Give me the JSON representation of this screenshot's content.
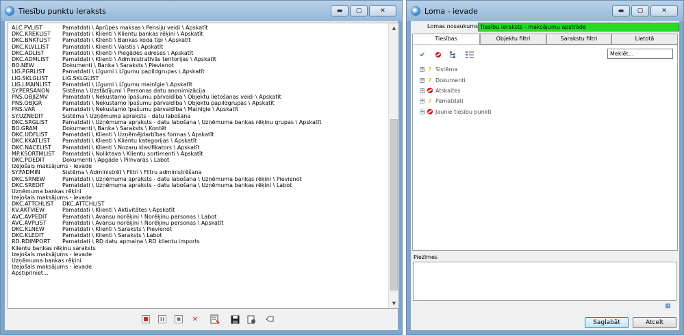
{
  "left_window": {
    "title": "Tiesību punktu ieraksts",
    "controls": {
      "minimize": "▬",
      "maximize": "▢",
      "close": "✕"
    },
    "log": [
      {
        "code": "ALC.PVLIST",
        "path": "Pamatdati \\ Aprūpes maksas \\ Pensiju veidi \\ Apskatīt"
      },
      {
        "code": "DKC.KREKLIST",
        "path": "Pamatdati \\ Klienti \\ Klientu bankas rēķini \\ Apskatīt"
      },
      {
        "code": "DKC.BNKTLIST",
        "path": "Pamatdati \\ Klienti \\ Bankas koda tipi \\ Apskatīt"
      },
      {
        "code": "DKC.KLVLLIST",
        "path": "Pamatdati \\ Klienti \\ Valstis \\ Apskatīt"
      },
      {
        "code": "DKC.ADLIST",
        "path": "Pamatdati \\ Klienti \\ Piegādes adreses \\ Apskatīt"
      },
      {
        "code": "DKC.ADMLIST",
        "path": "Pamatdati \\ Klienti \\ Administratīvās teritorijas \\ Apskatīt"
      },
      {
        "code": "BO.NEW",
        "path": "Dokumenti \\ Banka \\ Saraksts \\ Pievienot"
      },
      {
        "code": "LIG.PGRLIST",
        "path": "Pamatdati \\ Līgumi \\ Līgumu papildgrupas \\ Apskatīt"
      },
      {
        "code": "LIG.SKLGLIST",
        "path": "LIG.SKLGLIST"
      },
      {
        "code": "LIG.LMAINLIST",
        "path": "Pamatdati \\ Līgumi \\ Līgumu mainīgie \\ Apskatīt"
      },
      {
        "code": "SY.PERSANON",
        "path": "Sistēma \\ Uzstādījumi \\ Personas datu anonimizācija"
      },
      {
        "code": "PNS.OBJIZMV",
        "path": "Pamatdati \\ Nekustamo īpašumu pārvaldība \\ Objektu lietošanas veidi \\ Apskatīt"
      },
      {
        "code": "PNS.OBJGR",
        "path": "Pamatdati \\ Nekustamo īpašumu pārvaldība \\ Objektu papildgrupas \\ Apskatīt"
      },
      {
        "code": "PNS.VAR",
        "path": "Pamatdati \\ Nekustamo īpašumu pārvaldība \\ Mainīgie \\ Apskatīt"
      },
      {
        "code": "SY.UZNEDIT",
        "path": "Sistēma \\ Uzņēmuma apraksts - datu labošana"
      },
      {
        "code": "DKC.SRGLIST",
        "path": "Pamatdati \\ Uzņēmuma apraksts - datu labošana \\ Uzņēmuma bankas rēķinu grupas \\ Apskatīt"
      },
      {
        "code": "BO.GRAM",
        "path": "Dokumenti \\ Banka \\ Saraksts \\ Kontēt"
      },
      {
        "code": "DKC.UDFLIST",
        "path": "Pamatdati \\ Klienti \\ Uzņēmējdarbības formas \\ Apskatīt"
      },
      {
        "code": "DKC.KKATLIST",
        "path": "Pamatdati \\ Klienti \\ Klientu kategorijas \\ Apskatīt"
      },
      {
        "code": "DKC.NACELIST",
        "path": "Pamatdati \\ Klienti \\ Nozaru klasifikators \\ Apskatīt"
      },
      {
        "code": "MP.KSORTMLIST",
        "path": "Pamatdati \\ Noliktava \\ Klientu sortimenti \\ Apskatīt"
      },
      {
        "code": "DKC.PDEDIT",
        "path": "Dokumenti \\ Apgāde \\ Pilnvaras \\ Labot"
      },
      {
        "code": "",
        "path": "Izejošais maksājums - ievade"
      },
      {
        "code": "SY.FADMIN",
        "path": "Sistēma \\ Administrēt \\ Filtri \\ Filtru administrēšana"
      },
      {
        "code": "DKC.SRNEW",
        "path": "Pamatdati \\ Uzņēmuma apraksts - datu labošana \\ Uzņēmuma bankas rēķini \\ Pievienot"
      },
      {
        "code": "DKC.SREDIT",
        "path": "Pamatdati \\ Uzņēmuma apraksts - datu labošana \\ Uzņēmuma bankas rēķini \\ Labot"
      },
      {
        "code": "",
        "path": "Uzņēmuma bankas rēķini"
      },
      {
        "code": "",
        "path": "Izejošais maksājums - ievade"
      },
      {
        "code": "DKC.ATTCHLIST",
        "path": "DKC.ATTCHLIST"
      },
      {
        "code": "KV.AKTVIEW",
        "path": "Pamatdati \\ Klienti \\ Aktivitātes \\ Apskatīt"
      },
      {
        "code": "AVC.AVPEDIT",
        "path": "Pamatdati \\ Avansu norēķini \\ Norēķinu personas \\ Labot"
      },
      {
        "code": "AVC.AVPLIST",
        "path": "Pamatdati \\ Avansu norēķini \\ Norēķinu personas \\ Apskatīt"
      },
      {
        "code": "DKC.KLNEW",
        "path": "Pamatdati \\ Klienti \\ Saraksts \\ Pievienot"
      },
      {
        "code": "DKC.KLEDIT",
        "path": "Pamatdati \\ Klienti \\ Saraksts \\ Labot"
      },
      {
        "code": "RD.RDIMPORT",
        "path": "Pamatdati \\ RD datu apmaiņa \\ RD klientu imports"
      },
      {
        "code": "",
        "path": "Klientu bankas rēķinu saraksts"
      },
      {
        "code": "",
        "path": "Izejošais maksājums - ievade"
      },
      {
        "code": "",
        "path": "Uzņēmuma bankas rēķini"
      },
      {
        "code": "",
        "path": "Izejošais maksājums - ievade"
      },
      {
        "code": "",
        "path": "Apstipriniet..."
      }
    ]
  },
  "right_window": {
    "title": "Loma - ievade",
    "controls": {
      "minimize": "▬",
      "maximize": "▢",
      "close": "✕"
    },
    "role_name_label": "Lomas nosaukums:",
    "role_name_value": "Tiesību ieraksts - maksājumu apstrāde",
    "tabs": [
      "Tiesības",
      "Objektu filtri",
      "Sarakstu filtri",
      "Lietotā"
    ],
    "search_placeholder": "Meklēt...",
    "tree": [
      {
        "label": "Sistēma",
        "status": "q"
      },
      {
        "label": "Dokumenti",
        "status": "q"
      },
      {
        "label": "Atskaites",
        "status": "no"
      },
      {
        "label": "Pamatdati",
        "status": "q"
      },
      {
        "label": "Jaunie tiesību punkti",
        "status": "no"
      }
    ],
    "notes_label": "Piezīmes",
    "save_label": "Saglabāt",
    "cancel_label": "Atcelt"
  },
  "colors": {
    "title_bar": "#94b8d9",
    "role_name_bg": "#22dd22",
    "save_btn": "#bee6fd"
  }
}
